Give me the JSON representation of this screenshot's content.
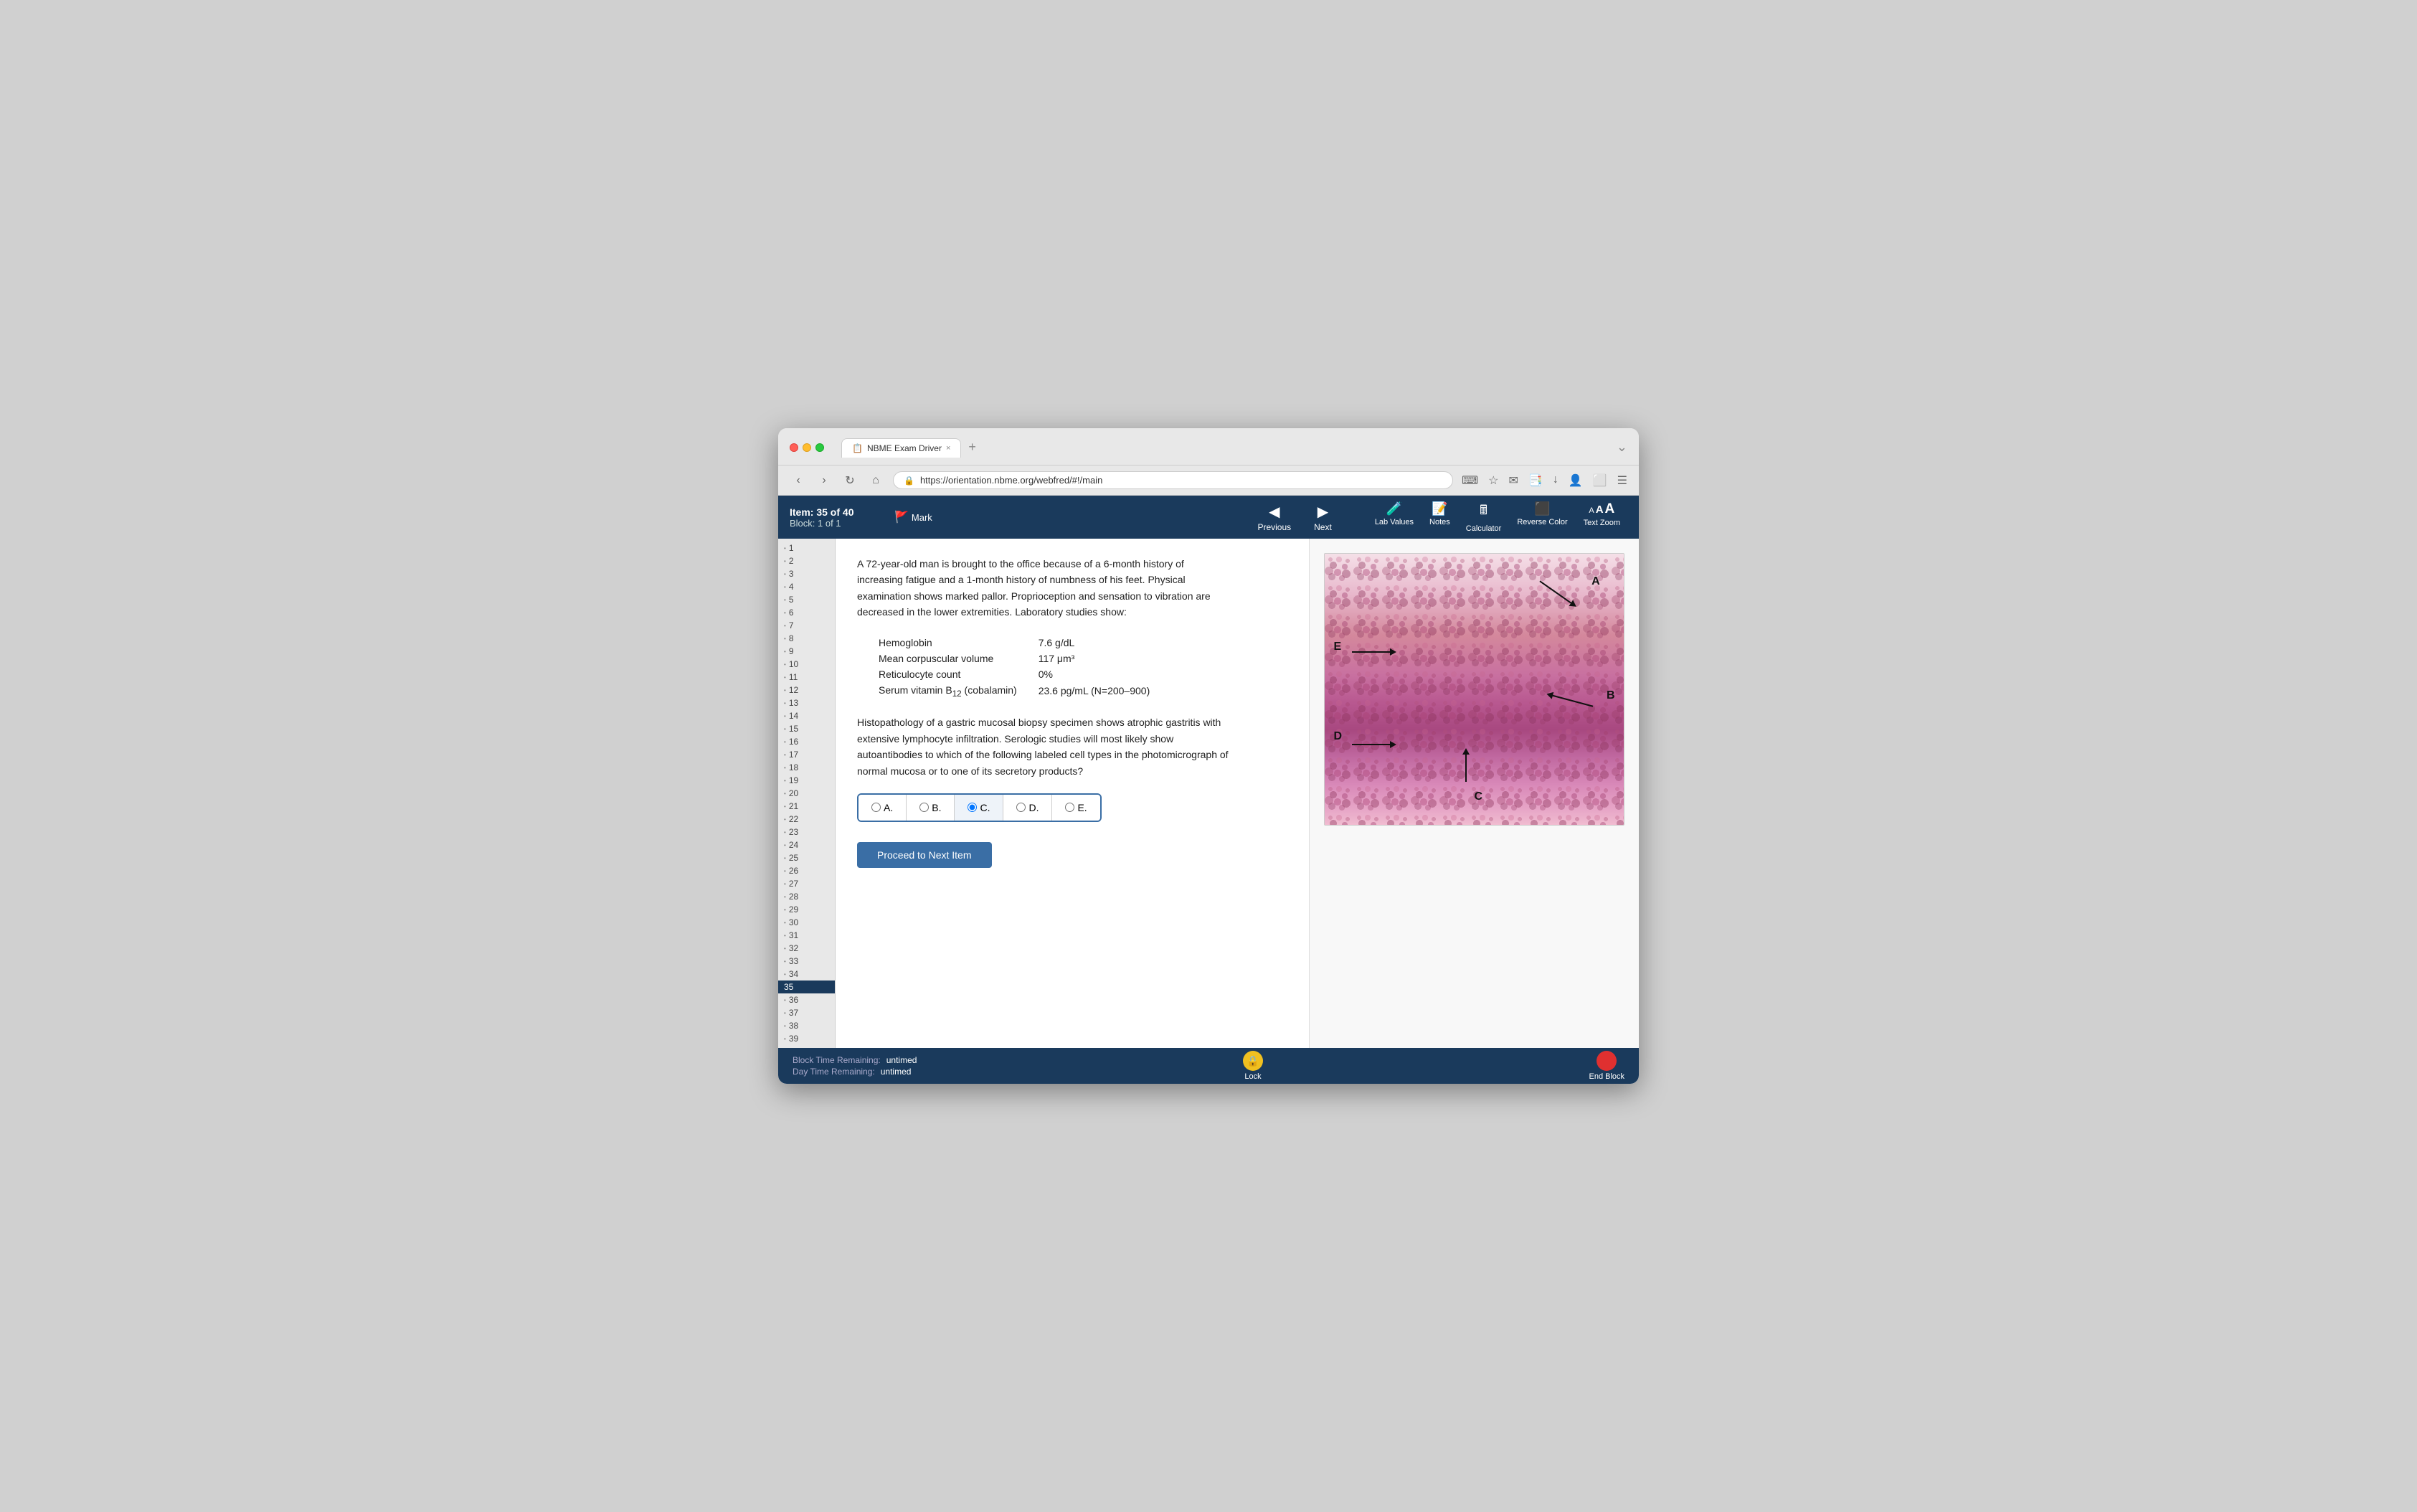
{
  "browser": {
    "title": "NBME Exam Driver",
    "url": "https://orientation.nbme.org/webfred/#!/main",
    "tab_close": "×",
    "new_tab": "+"
  },
  "header": {
    "item_label": "Item: 35 of 40",
    "block_label": "Block: 1 of 1",
    "mark_label": "Mark",
    "previous_label": "Previous",
    "next_label": "Next",
    "lab_values_label": "Lab Values",
    "notes_label": "Notes",
    "calculator_label": "Calculator",
    "reverse_color_label": "Reverse Color",
    "text_zoom_label": "Text Zoom"
  },
  "question": {
    "stem": "A 72-year-old man is brought to the office because of a 6-month history of increasing fatigue and a 1-month history of numbness of his feet. Physical examination shows marked pallor. Proprioception and sensation to vibration are decreased in the lower extremities. Laboratory studies show:",
    "lab_values": [
      {
        "test": "Hemoglobin",
        "value": "7.6 g/dL"
      },
      {
        "test": "Mean corpuscular volume",
        "value": "117 μm³"
      },
      {
        "test": "Reticulocyte count",
        "value": "0%"
      },
      {
        "test": "Serum vitamin B₁₂ (cobalamin)",
        "value": "23.6 pg/mL (N=200–900)"
      }
    ],
    "stem2": "Histopathology of a gastric mucosal biopsy specimen shows atrophic gastritis with extensive lymphocyte infiltration. Serologic studies will most likely show autoantibodies to which of the following labeled cell types in the photomicrograph of normal mucosa or to one of its secretory products?",
    "choices": [
      {
        "id": "A",
        "label": "A."
      },
      {
        "id": "B",
        "label": "B."
      },
      {
        "id": "C",
        "label": "C."
      },
      {
        "id": "D",
        "label": "D."
      },
      {
        "id": "E",
        "label": "E."
      }
    ],
    "selected_choice": "C",
    "proceed_button": "Proceed to Next Item"
  },
  "sidebar": {
    "items": [
      1,
      2,
      3,
      4,
      5,
      6,
      7,
      8,
      9,
      10,
      11,
      12,
      13,
      14,
      15,
      16,
      17,
      18,
      19,
      20,
      21,
      22,
      23,
      24,
      25,
      26,
      27,
      28,
      29,
      30,
      31,
      32,
      33,
      34,
      35,
      36,
      37,
      38,
      39
    ]
  },
  "bottom_bar": {
    "block_time_label": "Block Time Remaining:",
    "block_time_value": "untimed",
    "day_time_label": "Day Time Remaining:",
    "day_time_value": "untimed",
    "lock_label": "Lock",
    "end_block_label": "End Block"
  },
  "image": {
    "labels": [
      "A",
      "B",
      "C",
      "D",
      "E"
    ]
  }
}
